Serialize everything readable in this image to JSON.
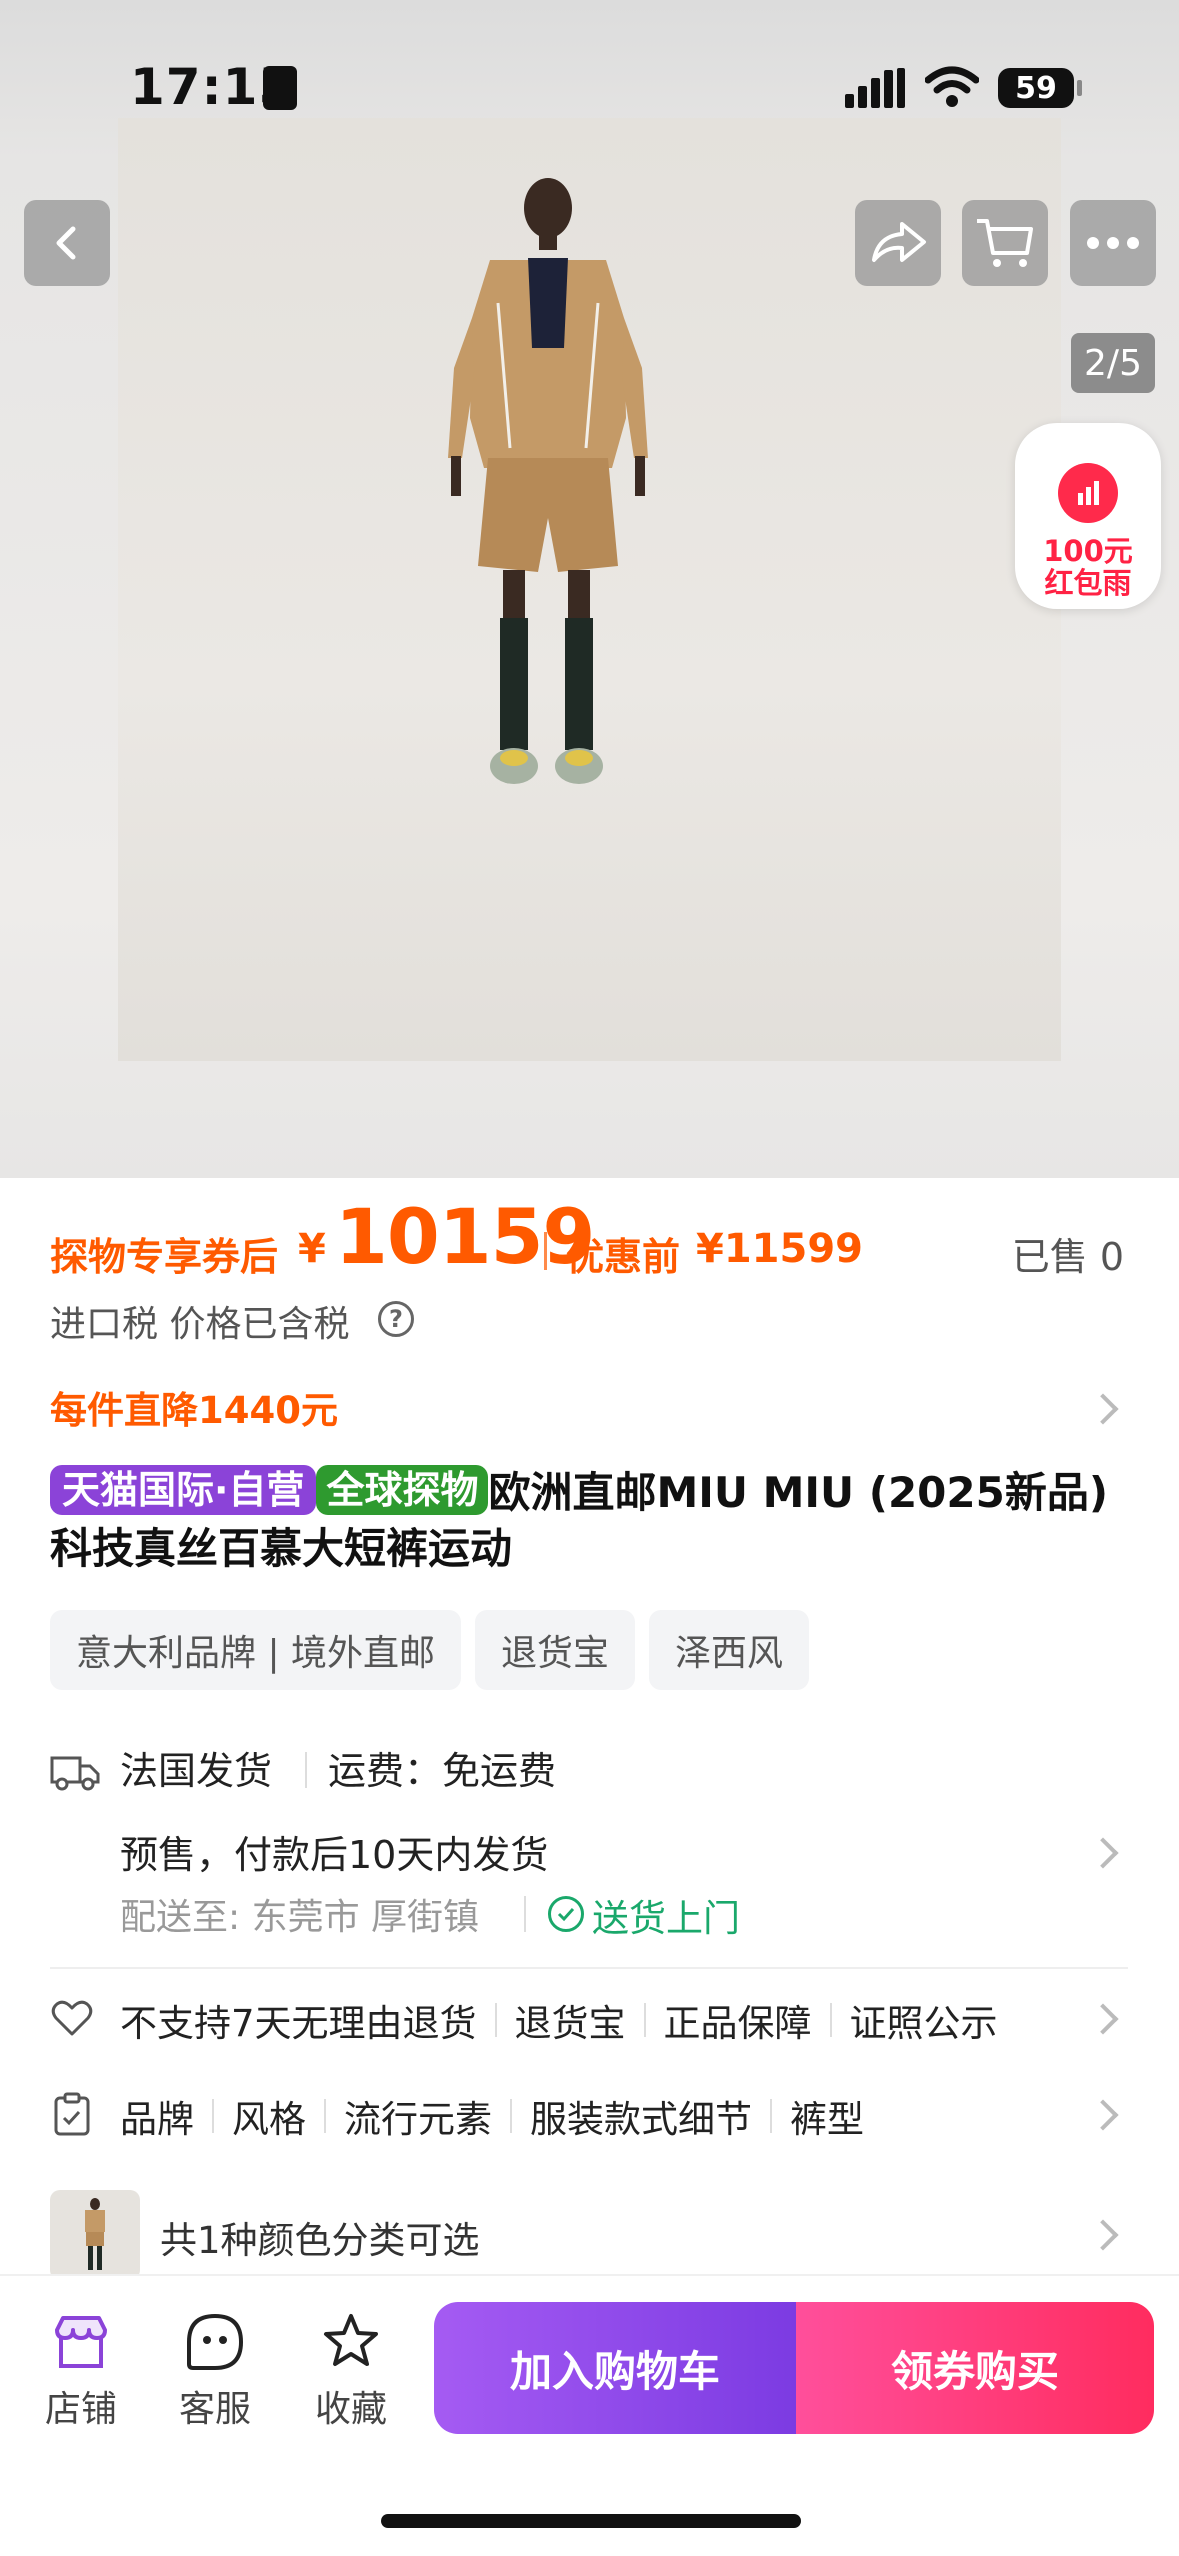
{
  "status_bar": {
    "time": "17:15",
    "battery": "59"
  },
  "gallery": {
    "pager": "2/5"
  },
  "red_rain": {
    "line1": "100元",
    "line2": "红包雨"
  },
  "icons": {
    "back": "chevron-left-icon",
    "share": "share-arrow-icon",
    "cart": "cart-icon",
    "more": "more-dots-icon",
    "tax_help": "question-circle-icon",
    "truck": "truck-icon",
    "check": "check-circle-icon",
    "heart": "heart-icon",
    "clipboard": "clipboard-icon",
    "store": "store-icon",
    "service": "chat-face-icon",
    "favorite": "star-icon"
  },
  "price": {
    "coupon_label": "探物专享券后",
    "currency": "¥",
    "value": "10159",
    "before_label": "优惠前",
    "before_value": "¥11599",
    "sold": "已售 0"
  },
  "tax_note": "进口税 价格已含税",
  "tax_help_symbol": "?",
  "discount_note": "每件直降1440元",
  "product": {
    "badge1": "天猫国际·自营",
    "badge2": "全球探物",
    "title": "欧洲直邮MIU MIU (2025新品) 科技真丝百慕大短裤运动"
  },
  "tags": [
    "意大利品牌 | 境外直邮",
    "退货宝",
    "泽西风"
  ],
  "shipping": {
    "origin": "法国发货",
    "fee": "运费：免运费",
    "presale": "预售，付款后10天内发货",
    "deliver_to": "配送至: 东莞市 厚街镇",
    "door_delivery": "送货上门"
  },
  "service_row": [
    "不支持7天无理由退货",
    "退货宝",
    "正品保障",
    "证照公示"
  ],
  "params_row": [
    "品牌",
    "风格",
    "流行元素",
    "服装款式细节",
    "裤型"
  ],
  "color_option": "共1种颜色分类可选",
  "bottom_bar": {
    "store": "店铺",
    "service": "客服",
    "favorite": "收藏",
    "add_cart": "加入购物车",
    "buy": "领券购买"
  },
  "colors": {
    "price_orange": "#ff5a00",
    "tmall_purple": "#8b43d8",
    "global_green": "#2e9a2f",
    "delivery_green": "#1aa86b",
    "cart_button": "#8a45e8",
    "buy_button": "#ff3a6e"
  }
}
